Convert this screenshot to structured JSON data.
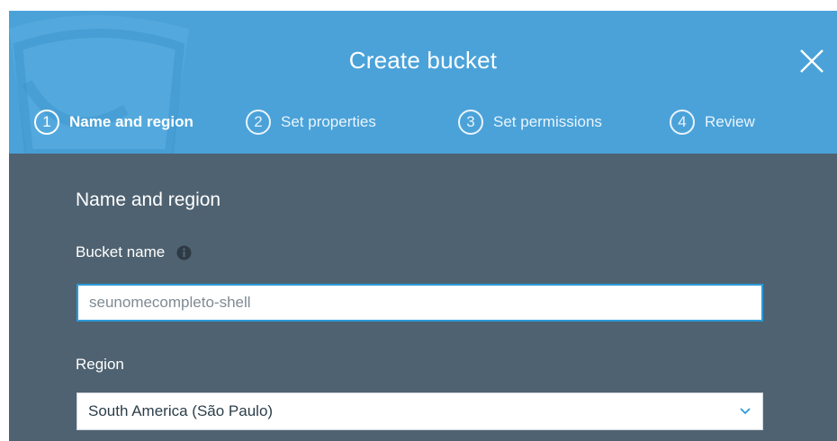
{
  "modal": {
    "title": "Create bucket"
  },
  "steps": [
    {
      "number": "1",
      "label": "Name and region"
    },
    {
      "number": "2",
      "label": "Set properties"
    },
    {
      "number": "3",
      "label": "Set permissions"
    },
    {
      "number": "4",
      "label": "Review"
    }
  ],
  "form": {
    "section_title": "Name and region",
    "bucket_name_label": "Bucket name",
    "bucket_name_value": "seunomecompleto-shell",
    "region_label": "Region",
    "region_value": "South America (São Paulo)"
  },
  "icons": {
    "close": "close-icon",
    "info": "info-icon",
    "dropdown": "chevron-down-icon"
  },
  "colors": {
    "header_bg": "#4aa2d9",
    "body_bg": "#4f6271",
    "input_border": "#2b9bd8"
  }
}
